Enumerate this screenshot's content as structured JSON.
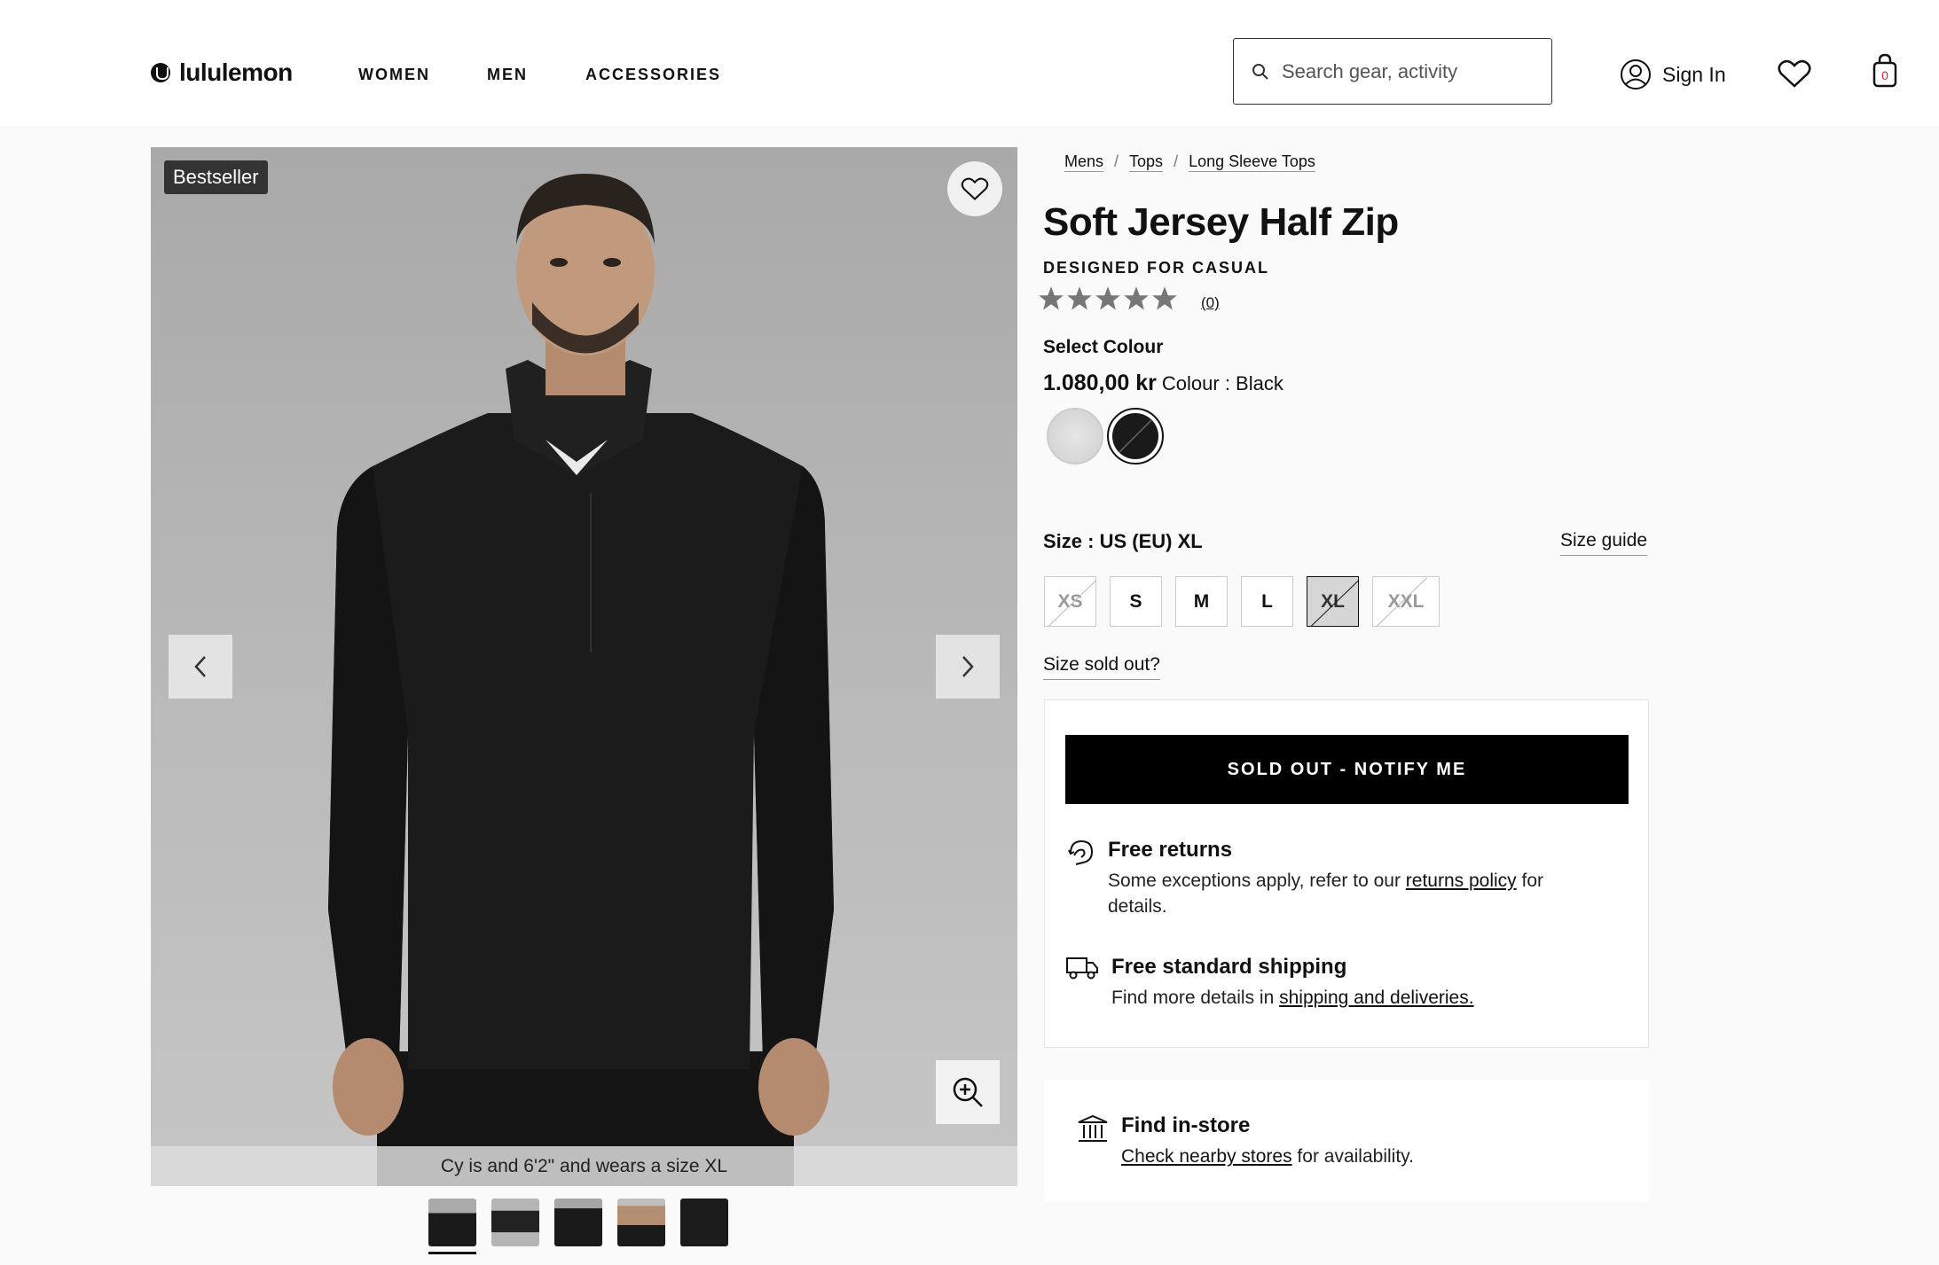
{
  "header": {
    "logo_text": "lululemon",
    "nav": [
      "WOMEN",
      "MEN",
      "ACCESSORIES"
    ],
    "search_placeholder": "Search gear, activity",
    "sign_in": "Sign In",
    "cart_count": "0"
  },
  "gallery": {
    "badge": "Bestseller",
    "caption": "Cy is and 6'2\" and wears a size XL",
    "thumbnail_count": 5,
    "active_thumbnail": 1
  },
  "breadcrumb": [
    "Mens",
    "Tops",
    "Long Sleeve Tops"
  ],
  "product": {
    "title": "Soft Jersey Half Zip",
    "designed_for": "DESIGNED FOR CASUAL",
    "rating": 0,
    "review_count": "(0)",
    "select_colour_label": "Select Colour",
    "price": "1.080,00 kr",
    "colour_text": "Colour : Black",
    "colours": [
      {
        "name": "Light Grey",
        "hex": "#dcdcdc",
        "selected": false
      },
      {
        "name": "Black",
        "hex": "#1a1a1a",
        "selected": true
      }
    ],
    "size_label": "Size : US (EU) XL",
    "size_guide": "Size guide",
    "sizes": [
      {
        "label": "XS",
        "sold_out": true,
        "selected": false
      },
      {
        "label": "S",
        "sold_out": false,
        "selected": false
      },
      {
        "label": "M",
        "sold_out": false,
        "selected": false
      },
      {
        "label": "L",
        "sold_out": false,
        "selected": false
      },
      {
        "label": "XL",
        "sold_out": true,
        "selected": true
      },
      {
        "label": "XXL",
        "sold_out": true,
        "selected": false
      }
    ],
    "size_sold_out_link": "Size sold out?",
    "notify_button": "SOLD OUT - NOTIFY ME"
  },
  "features": {
    "returns_title": "Free returns",
    "returns_text_pre": "Some exceptions apply, refer to our ",
    "returns_link": "returns policy",
    "returns_text_post": " for details.",
    "shipping_title": "Free standard shipping",
    "shipping_text_pre": "Find more details in ",
    "shipping_link": "shipping and deliveries."
  },
  "store": {
    "title": "Find in-store",
    "link": "Check nearby stores",
    "text_post": " for availability."
  },
  "colors": {
    "accent": "#000000",
    "background": "#fafafa",
    "cart_badge": "#d22630"
  }
}
